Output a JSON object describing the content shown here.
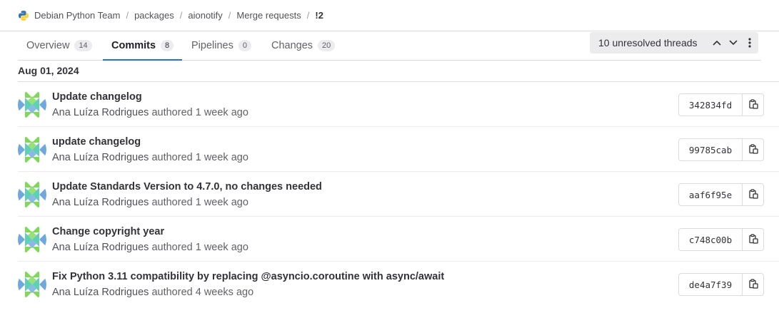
{
  "breadcrumb": {
    "items": [
      "Debian Python Team",
      "packages",
      "aionotify",
      "Merge requests"
    ],
    "separator": "/",
    "current": "!2",
    "logo_icon": "python-logo-icon"
  },
  "tabs": [
    {
      "label": "Overview",
      "count": "14"
    },
    {
      "label": "Commits",
      "count": "8",
      "active": true
    },
    {
      "label": "Pipelines",
      "count": "0"
    },
    {
      "label": "Changes",
      "count": "20"
    }
  ],
  "threads": {
    "label": "10 unresolved threads",
    "prev_icon": "chevron-up-icon",
    "next_icon": "chevron-down-icon",
    "menu_icon": "more-vertical-icon"
  },
  "date_heading": "Aug 01, 2024",
  "commits": [
    {
      "title": "Update changelog",
      "author": "Ana Luíza Rodrigues",
      "action": "authored",
      "time": "1 week ago",
      "sha": "342834fd"
    },
    {
      "title": "update changelog",
      "author": "Ana Luíza Rodrigues",
      "action": "authored",
      "time": "1 week ago",
      "sha": "99785cab"
    },
    {
      "title": "Update Standards Version to 4.7.0, no changes needed",
      "author": "Ana Luíza Rodrigues",
      "action": "authored",
      "time": "1 week ago",
      "sha": "aaf6f95e"
    },
    {
      "title": "Change copyright year",
      "author": "Ana Luíza Rodrigues",
      "action": "authored",
      "time": "1 week ago",
      "sha": "c748c00b"
    },
    {
      "title": "Fix Python 3.11 compatibility by replacing @asyncio.coroutine with async/await",
      "author": "Ana Luíza Rodrigues",
      "action": "authored",
      "time": "4 weeks ago",
      "sha": "de4a7f39"
    }
  ],
  "colors": {
    "accent": "#1f75cb",
    "avatar_teal": "#5fcfb8",
    "avatar_blue": "#6fa8dc",
    "avatar_green": "#7ed957"
  },
  "icons": {
    "copy": "copy-icon",
    "avatar": "identicon-avatar"
  }
}
